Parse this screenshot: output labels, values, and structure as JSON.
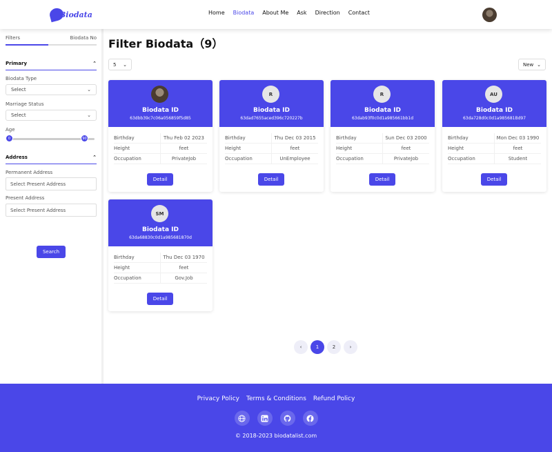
{
  "header": {
    "logo_text": "Biodata",
    "nav": [
      {
        "label": "Home"
      },
      {
        "label": "Biodata"
      },
      {
        "label": "About Me"
      },
      {
        "label": "Ask"
      },
      {
        "label": "Direction"
      },
      {
        "label": "Contact"
      }
    ]
  },
  "sidebar": {
    "tab_filters": "Filters",
    "tab_biodata_no": "Biodata No",
    "primary_title": "Primary",
    "biodata_type_label": "Biodata Type",
    "biodata_type_value": "Select",
    "marriage_status_label": "Marriage Status",
    "marriage_status_value": "Select",
    "age_label": "Age",
    "age_min": "0",
    "age_max": "90",
    "address_title": "Address",
    "permanent_label": "Permanent Address",
    "permanent_placeholder": "Select Present Address",
    "present_label": "Present Address",
    "present_placeholder": "Select Present Address",
    "search_label": "Search"
  },
  "main": {
    "title": "Filter Biodata（9）",
    "per_page": "5",
    "sort": "New",
    "row_labels": {
      "birthday": "Birthday",
      "height": "Height",
      "occupation": "Occupation"
    },
    "detail_label": "Detail",
    "card_title": "Biodata ID",
    "cards": [
      {
        "initials": "",
        "id": "63dbb39c7c06a056859f5d85",
        "birthday": "Thu Feb 02 2023",
        "height": "feet",
        "occupation": "PrivateJob"
      },
      {
        "initials": "R",
        "id": "63dad7655aced396c720227b",
        "birthday": "Thu Dec 03 2015",
        "height": "feet",
        "occupation": "UnEmployee"
      },
      {
        "initials": "R",
        "id": "63dab93f0c0d1a985661bb1d",
        "birthday": "Sun Dec 03 2000",
        "height": "feet",
        "occupation": "PrivateJob"
      },
      {
        "initials": "AU",
        "id": "63da728d0c0d1a985681Bd97",
        "birthday": "Mon Dec 03 1990",
        "height": "feet",
        "occupation": "Student"
      },
      {
        "initials": "SM",
        "id": "63da68830c0d1a985681870d",
        "birthday": "Thu Dec 03 1970",
        "height": "feet",
        "occupation": "Gov.Job"
      }
    ]
  },
  "pagination": {
    "prev": "‹",
    "pages": [
      "1",
      "2"
    ],
    "next": "›",
    "active": "1"
  },
  "footer": {
    "links": [
      "Privacy Policy",
      "Terms & Conditions",
      "Refund Policy"
    ],
    "icons": [
      "globe-icon",
      "linkedin-icon",
      "github-icon",
      "facebook-icon"
    ],
    "copyright": "© 2018-2023 biodatalist.com"
  },
  "colors": {
    "accent": "#4a47e8"
  }
}
